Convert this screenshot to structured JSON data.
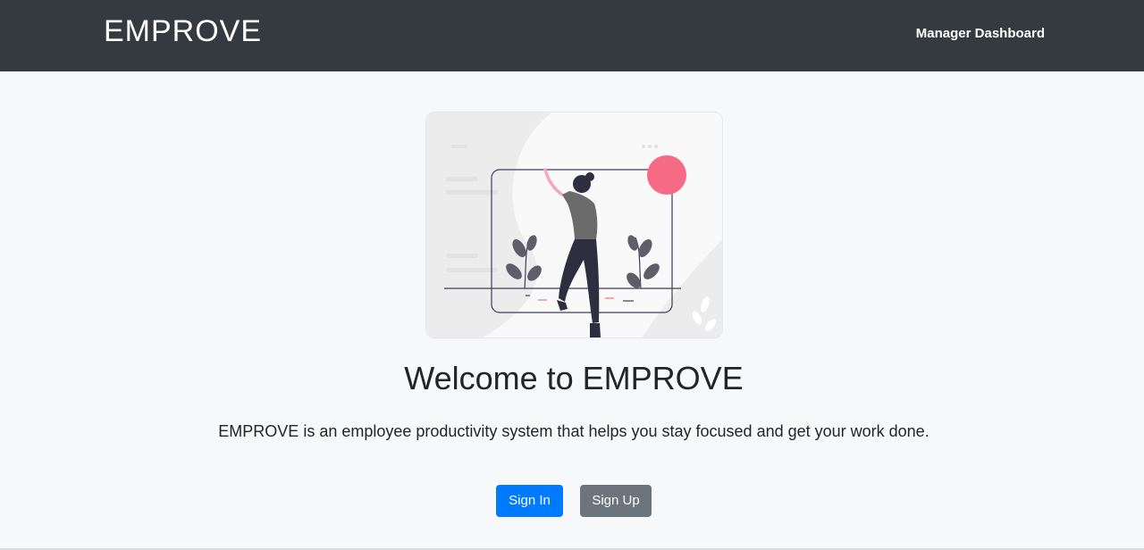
{
  "navbar": {
    "brand": "EMPROVE",
    "link_label": "Manager Dashboard"
  },
  "hero": {
    "illustration": "person-at-whiteboard-illustration",
    "title": "Welcome to EMPROVE",
    "subtitle": "EMPROVE is an employee productivity system that helps you stay focused and get your work done."
  },
  "actions": {
    "sign_in_label": "Sign In",
    "sign_up_label": "Sign Up"
  },
  "colors": {
    "navbar_bg": "#343a40",
    "page_bg": "#f7f8fa",
    "primary": "#007bff",
    "secondary": "#6c757d",
    "accent_dot": "#f76a85"
  }
}
